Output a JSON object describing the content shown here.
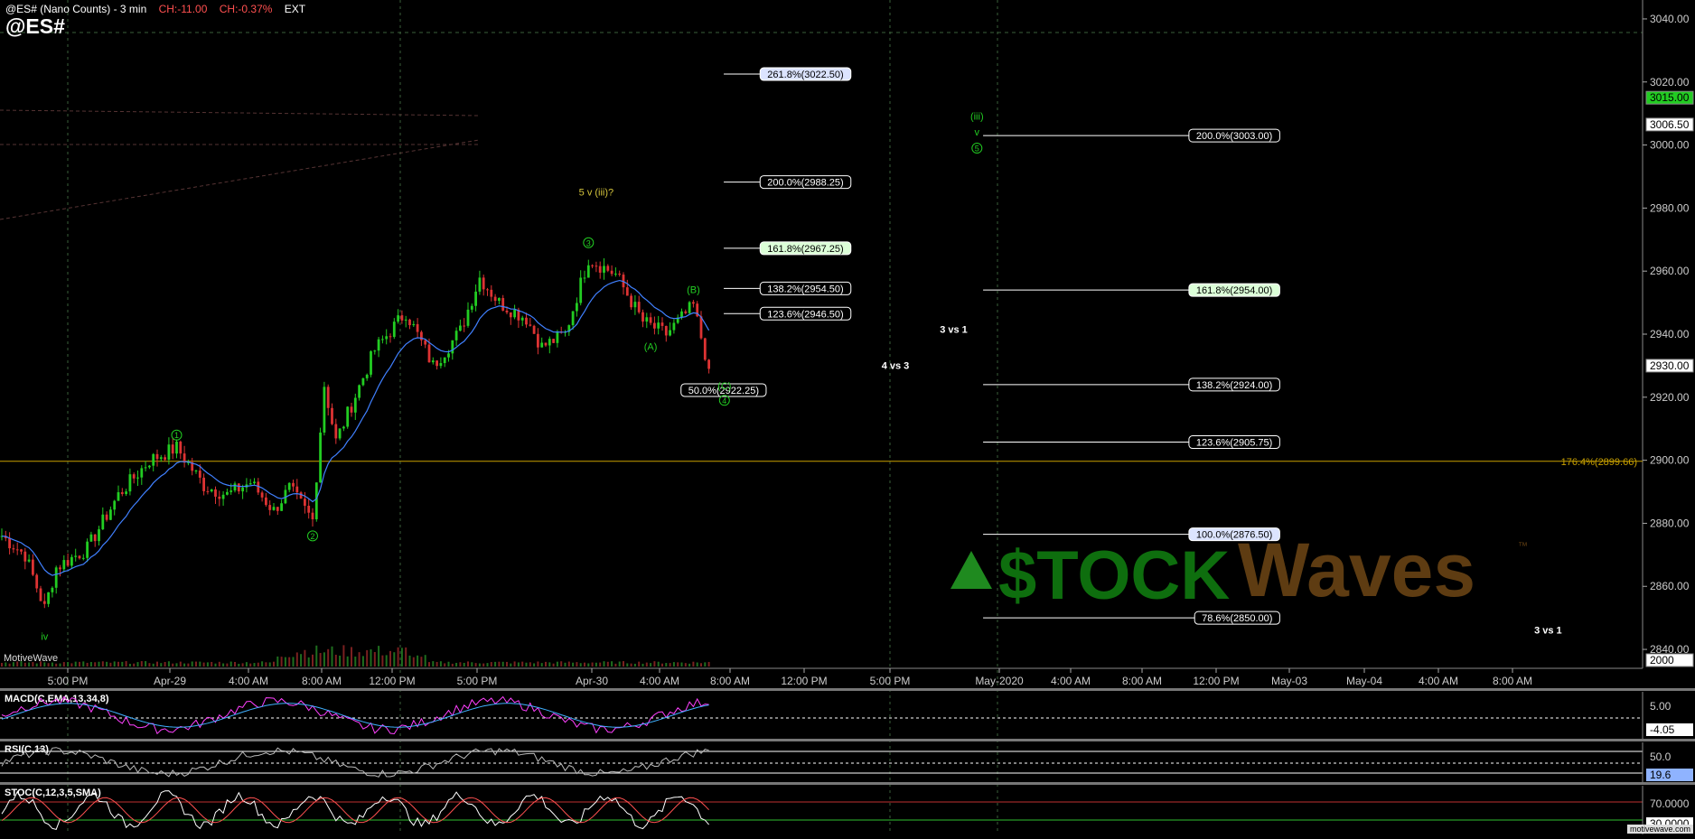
{
  "header": {
    "title": "@ES# (Nano Counts) - 3 min",
    "change": "CH:-11.00",
    "change_pct": "CH:-0.37%",
    "session": "EXT",
    "symbol": "@ES#"
  },
  "brand": "MotiveWave",
  "footer": "motivewave.com",
  "colors": {
    "bull_candle": "#22cc22",
    "bear_candle": "#dd3333",
    "fib_line": "#ffffff",
    "wave_label": "#22cc22",
    "annotation": "#d4c43c",
    "horizontal_line": "#c8a000",
    "ma_line": "#4080ff",
    "macd_line": "#ff40ff"
  },
  "logo": {
    "text_left": "$TOCK",
    "text_right": "Waves",
    "mark": "™"
  },
  "chart_data": {
    "type": "candlestick",
    "title": "@ES# (Nano Counts) - 3 min",
    "ylim": [
      2834,
      3046
    ],
    "y_ticks": [
      2840,
      2860,
      2880,
      2900,
      2920,
      2940,
      2960,
      2980,
      3000,
      3020,
      3040
    ],
    "y_tick_labels": [
      "2840.00",
      "2860.00",
      "2880.00",
      "2900.00",
      "2920.00",
      "2940.00",
      "2960.00",
      "2980.00",
      "3000.00",
      "3020.00",
      "3040.00"
    ],
    "x_tick_labels": [
      "5:00 PM",
      "Apr-29",
      "4:00 AM",
      "8:00 AM",
      "12:00 PM",
      "5:00 PM",
      "Apr-30",
      "4:00 AM",
      "8:00 AM",
      "12:00 PM",
      "5:00 PM",
      "May-2020",
      "4:00 AM",
      "8:00 AM",
      "12:00 PM",
      "May-03",
      "May-04",
      "4:00 AM",
      "8:00 AM"
    ],
    "price_path": [
      {
        "bar": 0,
        "price": 2876
      },
      {
        "bar": 6,
        "price": 2870
      },
      {
        "bar": 11,
        "price": 2853
      },
      {
        "bar": 14,
        "price": 2866
      },
      {
        "bar": 22,
        "price": 2872
      },
      {
        "bar": 30,
        "price": 2889
      },
      {
        "bar": 38,
        "price": 2900
      },
      {
        "bar": 45,
        "price": 2904
      },
      {
        "bar": 52,
        "price": 2892
      },
      {
        "bar": 58,
        "price": 2889
      },
      {
        "bar": 64,
        "price": 2893
      },
      {
        "bar": 70,
        "price": 2884
      },
      {
        "bar": 74,
        "price": 2891
      },
      {
        "bar": 80,
        "price": 2881
      },
      {
        "bar": 83,
        "price": 2924
      },
      {
        "bar": 86,
        "price": 2906
      },
      {
        "bar": 96,
        "price": 2935
      },
      {
        "bar": 104,
        "price": 2947
      },
      {
        "bar": 111,
        "price": 2930
      },
      {
        "bar": 118,
        "price": 2941
      },
      {
        "bar": 123,
        "price": 2958
      },
      {
        "bar": 128,
        "price": 2950
      },
      {
        "bar": 135,
        "price": 2945
      },
      {
        "bar": 139,
        "price": 2936
      },
      {
        "bar": 145,
        "price": 2940
      },
      {
        "bar": 151,
        "price": 2964
      },
      {
        "bar": 158,
        "price": 2959
      },
      {
        "bar": 165,
        "price": 2944
      },
      {
        "bar": 171,
        "price": 2940
      },
      {
        "bar": 178,
        "price": 2949
      },
      {
        "bar": 182,
        "price": 2929
      }
    ],
    "last_price": "2930.00",
    "price_markers": [
      {
        "price": 3015,
        "label": "3015.00",
        "color": "#22cc22"
      },
      {
        "price": 3006.5,
        "label": "3006.50",
        "color": "#ffffff"
      },
      {
        "price": 2930,
        "label": "2930.00",
        "color": "#ffffff"
      },
      {
        "price": 2836,
        "label": "2000",
        "color": "#ffffff"
      }
    ],
    "horizontal_line": {
      "price": 2899.66,
      "label": "176.4%(2899.66)"
    },
    "fib_levels": [
      {
        "label": "261.8%(3022.50)",
        "price": 3022.5,
        "x1": 0.427,
        "x2": 0.502,
        "style": "blue"
      },
      {
        "label": "200.0%(2988.25)",
        "price": 2988.25,
        "x1": 0.427,
        "x2": 0.502,
        "style": "plain"
      },
      {
        "label": "161.8%(2967.25)",
        "price": 2967.25,
        "x1": 0.427,
        "x2": 0.502,
        "style": "green"
      },
      {
        "label": "138.2%(2954.50)",
        "price": 2954.5,
        "x1": 0.427,
        "x2": 0.502,
        "style": "plain"
      },
      {
        "label": "123.6%(2946.50)",
        "price": 2946.5,
        "x1": 0.427,
        "x2": 0.502,
        "style": "plain"
      },
      {
        "label": "50.0%(2922.25)",
        "price": 2922.25,
        "x1": 0.43,
        "x2": 0.452,
        "style": "plain"
      },
      {
        "label": "200.0%(3003.00)",
        "price": 3003,
        "x1": 0.58,
        "x2": 0.755,
        "style": "plain"
      },
      {
        "label": "161.8%(2954.00)",
        "price": 2954,
        "x1": 0.58,
        "x2": 0.755,
        "style": "green"
      },
      {
        "label": "138.2%(2924.00)",
        "price": 2924,
        "x1": 0.58,
        "x2": 0.755,
        "style": "plain"
      },
      {
        "label": "123.6%(2905.75)",
        "price": 2905.75,
        "x1": 0.58,
        "x2": 0.755,
        "style": "plain"
      },
      {
        "label": "100.0%(2876.50)",
        "price": 2876.5,
        "x1": 0.58,
        "x2": 0.755,
        "style": "blue"
      },
      {
        "label": "78.6%(2850.00)",
        "price": 2850,
        "x1": 0.58,
        "x2": 0.755,
        "style": "plain"
      }
    ],
    "annotations": [
      {
        "text": "3 vs 1",
        "bar": 245,
        "price": 2940.5
      },
      {
        "text": "4 vs 3",
        "bar": 230,
        "price": 2929
      },
      {
        "text": "3 vs 1",
        "bar": 398,
        "price": 2845
      }
    ],
    "wave_labels": [
      {
        "text": "iv",
        "bar": 11,
        "price": 2844,
        "circle": false
      },
      {
        "text": "1",
        "bar": 45,
        "price": 2908,
        "circle": true
      },
      {
        "text": "2",
        "bar": 80,
        "price": 2876,
        "circle": true
      },
      {
        "text": "3",
        "bar": 151,
        "price": 2969,
        "circle": true
      },
      {
        "text": "(A)",
        "bar": 167,
        "price": 2936,
        "circle": false
      },
      {
        "text": "(B)",
        "bar": 178,
        "price": 2954,
        "circle": false
      },
      {
        "text": "(C)",
        "bar": 186,
        "price": 2923.5,
        "circle": false
      },
      {
        "text": "4",
        "bar": 186,
        "price": 2919,
        "circle": true
      },
      {
        "text": "(iii)",
        "bar": 251,
        "price": 3009,
        "circle": false
      },
      {
        "text": "v",
        "bar": 251,
        "price": 3004,
        "circle": false
      },
      {
        "text": "5",
        "bar": 251,
        "price": 2999,
        "circle": true
      }
    ],
    "wave_question": {
      "text": "5 v (iii)?",
      "bar": 153,
      "price": 2984
    }
  },
  "indicators": {
    "macd": {
      "label": "MACD(C,EMA,13,34,8)",
      "ticks": [
        "5.00",
        "-4.05"
      ]
    },
    "rsi": {
      "label": "RSI(C,13)",
      "ticks": [
        "50.0",
        "19.6"
      ]
    },
    "stoch": {
      "label": "STOC(C,12,3,5,SMA)",
      "ticks": [
        "70.0000",
        "30.0000"
      ]
    }
  }
}
